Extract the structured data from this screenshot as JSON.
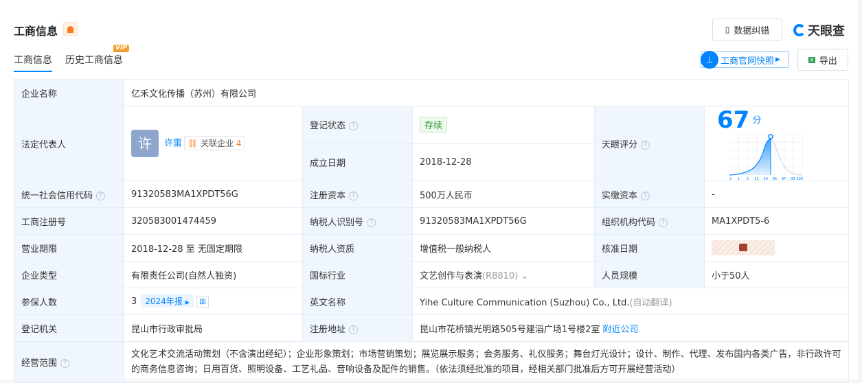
{
  "header": {
    "title": "工商信息",
    "tabs": [
      {
        "label": "工商信息"
      },
      {
        "label": "历史工商信息"
      }
    ],
    "vip_badge": "VIP",
    "correct_button": "数据纠错",
    "logo": "天眼查",
    "snapshot_button": "工商官网快照",
    "export_button": "导出"
  },
  "company": {
    "name_label": "企业名称",
    "name": "亿禾文化传播（苏州）有限公司",
    "legal_label": "法定代表人",
    "legal_avatar": "许",
    "legal_name": "许雷",
    "related_label": "关联企业",
    "related_count": "4",
    "status_label": "登记状态",
    "status": "存续",
    "found_label": "成立日期",
    "found": "2018-12-28",
    "score_label": "天眼评分",
    "score": "67",
    "score_unit": "分",
    "credit_label": "统一社会信用代码",
    "credit": "91320583MA1XPDT56G",
    "capital_label": "注册资本",
    "capital": "500万人民币",
    "paid_label": "实缴资本",
    "paid": "-",
    "regno_label": "工商注册号",
    "regno": "320583001474459",
    "taxid_label": "纳税人识别号",
    "taxid": "91320583MA1XPDT56G",
    "org_label": "组织机构代码",
    "org": "MA1XPDT5-6",
    "term_label": "营业期限",
    "term": "2018-12-28 至 无固定期限",
    "taxq_label": "纳税人资质",
    "taxq": "增值税一般纳税人",
    "approve_label": "核准日期",
    "type_label": "企业类型",
    "type": "有限责任公司(自然人独资)",
    "industry_label": "国标行业",
    "industry": "文艺创作与表演",
    "industry_code": "(R8810)",
    "staff_label": "人员规模",
    "staff": "小于50人",
    "insured_label": "参保人数",
    "insured": "3",
    "report": "2024年报",
    "en_label": "英文名称",
    "en_name": "Yihe Culture Communication (Suzhou) Co., Ltd.",
    "auto_translate": "(自动翻译)",
    "authority_label": "登记机关",
    "authority": "昆山市行政审批局",
    "address_label": "注册地址",
    "address": "昆山市花桥镇光明路505号建滔广场1号楼2室",
    "nearby": "附近公司",
    "scope_label": "经营范围",
    "scope": "文化艺术交流活动策划（不含演出经纪）；企业形象策划；市场营销策划；展览展示服务；会务服务、礼仪服务；舞台灯光设计；设计、制作、代理、发布国内各类广告，非行政许可的商务信息咨询；日用百货、照明设备、工艺礼品、音响设备及配件的销售。（依法须经批准的项目，经相关部门批准后方可开展经营活动）"
  },
  "score_chart": {
    "ticks": [
      "0",
      "1",
      "3",
      "15",
      "50",
      "85",
      "97",
      "99",
      "100"
    ],
    "marker_percentile": 60,
    "accent": "#0084ff"
  }
}
